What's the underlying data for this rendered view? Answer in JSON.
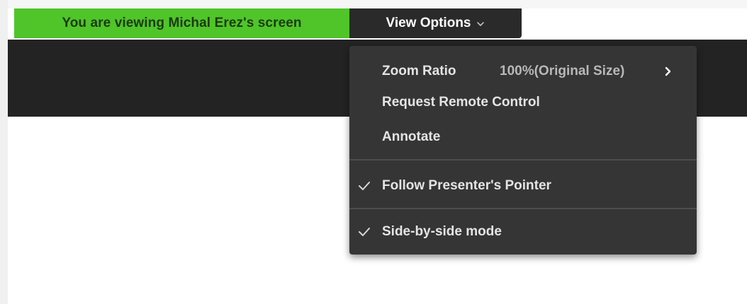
{
  "banner": {
    "viewing_text": "You are viewing Michal Erez's screen",
    "background_color": "#4fc52a",
    "text_color": "#1d3a10"
  },
  "view_options": {
    "label": "View Options",
    "icon": "chevron-down-icon"
  },
  "menu": {
    "items": [
      {
        "label": "Zoom Ratio",
        "value": "100%(Original Size)",
        "icon": "chevron-right-icon",
        "checked": false
      },
      {
        "label": "Request Remote Control",
        "checked": false
      },
      {
        "label": "Annotate",
        "checked": false
      },
      {
        "label": "Follow Presenter's Pointer",
        "checked": true,
        "icon": "checkmark-icon"
      },
      {
        "label": "Side-by-side mode",
        "checked": true,
        "icon": "checkmark-icon"
      }
    ],
    "background_color": "#353535"
  }
}
